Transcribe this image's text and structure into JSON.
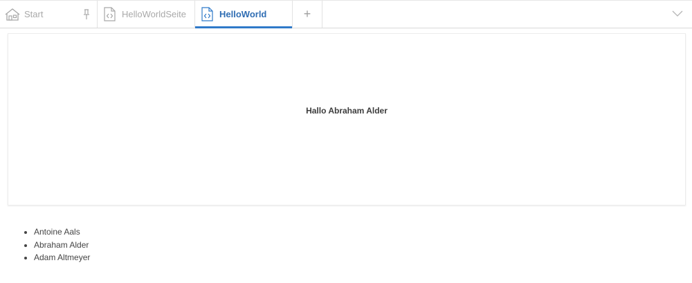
{
  "tabs": [
    {
      "label": "Start",
      "icon": "home-icon",
      "pinned": true,
      "active": false
    },
    {
      "label": "HelloWorldSeite",
      "icon": "code-file-icon",
      "active": false
    },
    {
      "label": "HelloWorld",
      "icon": "code-file-icon",
      "active": true
    }
  ],
  "add_tab_label": "+",
  "colors": {
    "accent": "#2f7ac9",
    "inactive_text": "#a9a9a9",
    "body_text": "#444444"
  },
  "main": {
    "greeting": "Hallo Abraham Alder"
  },
  "people": [
    "Antoine Aals",
    "Abraham Alder",
    "Adam Altmeyer"
  ]
}
